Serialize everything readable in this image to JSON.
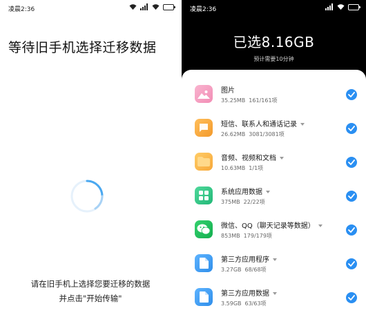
{
  "left": {
    "status_time": "凌晨2:36",
    "title": "等待旧手机选择迁移数据",
    "hint_line1": "请在旧手机上选择您要迁移的数据",
    "hint_line2": "并点击\"开始传输\""
  },
  "right": {
    "status_time": "凌晨2:36",
    "selected_title": "已选8.16GB",
    "estimate": "预计需要10分钟",
    "items": [
      {
        "name": "图片",
        "size": "35.25MB",
        "count": "161/161项",
        "has_dropdown": false,
        "icon": "photos-icon",
        "color": "#f7a9c8",
        "checked": true
      },
      {
        "name": "短信、联系人和通话记录",
        "size": "26.62MB",
        "count": "3081/3081项",
        "has_dropdown": true,
        "icon": "messages-icon",
        "color": "#f6a63c",
        "checked": true
      },
      {
        "name": "音频、视频和文档",
        "size": "10.63MB",
        "count": "1/1项",
        "has_dropdown": true,
        "icon": "folder-icon",
        "color": "#fbb84a",
        "checked": true
      },
      {
        "name": "系统应用数据",
        "size": "375MB",
        "count": "22/22项",
        "has_dropdown": true,
        "icon": "system-apps-icon",
        "color": "#3cc98a",
        "checked": true
      },
      {
        "name": "微信、QQ（聊天记录等数据）",
        "size": "853MB",
        "count": "179/179项",
        "has_dropdown": true,
        "icon": "wechat-icon",
        "color": "#1fc15e",
        "checked": true
      },
      {
        "name": "第三方应用程序",
        "size": "3.27GB",
        "count": "68/68项",
        "has_dropdown": true,
        "icon": "file-icon",
        "color": "#4aa3f5",
        "checked": true
      },
      {
        "name": "第三方应用数据",
        "size": "3.59GB",
        "count": "63/63项",
        "has_dropdown": true,
        "icon": "file-icon",
        "color": "#4aa3f5",
        "checked": true
      }
    ]
  },
  "colors": {
    "accent": "#2a8ff2",
    "spinner": "#4aa8f0"
  }
}
